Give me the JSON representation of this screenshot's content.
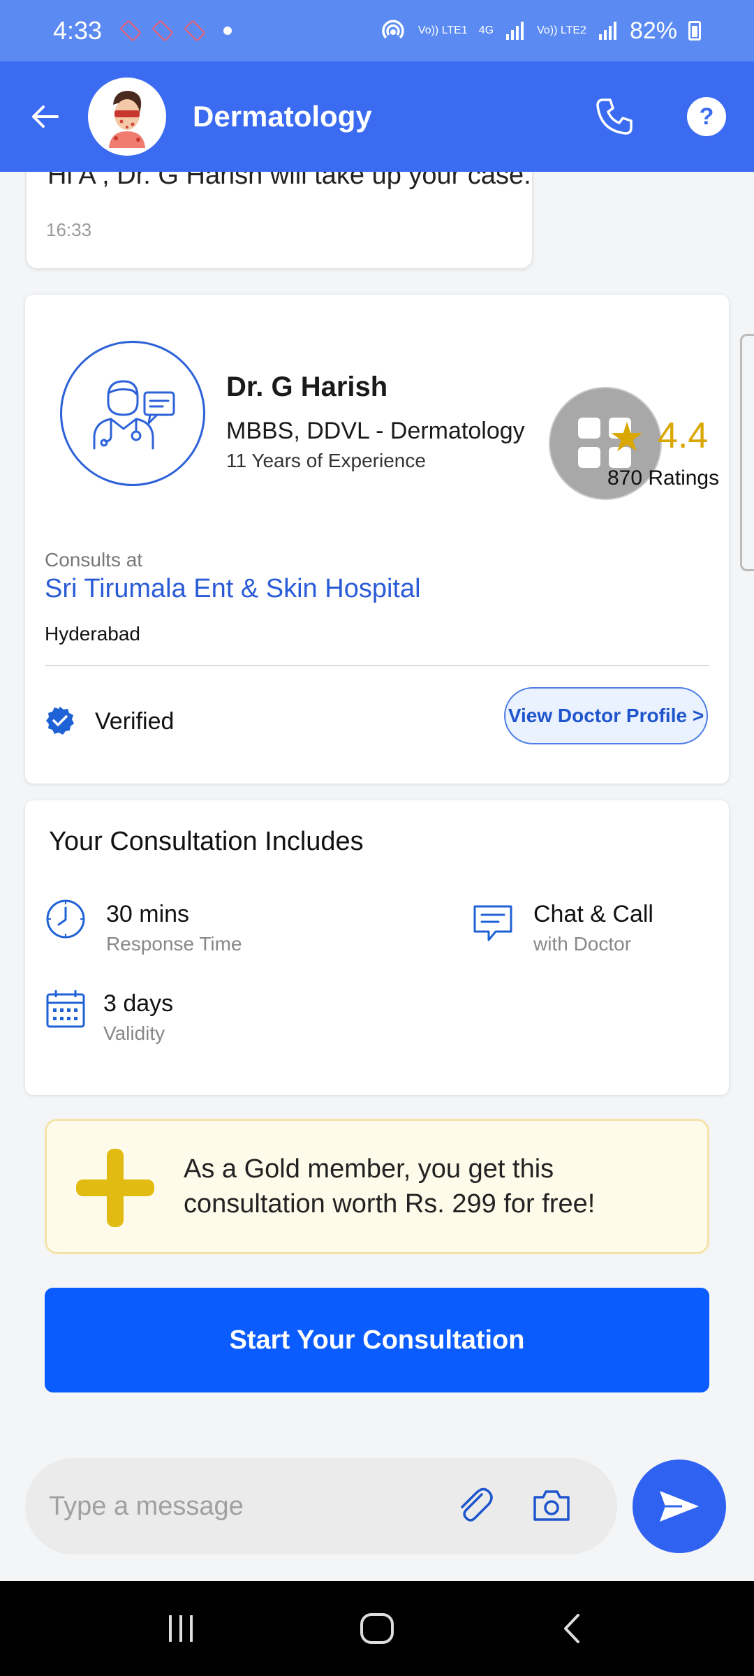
{
  "status_bar": {
    "time": "4:33",
    "sim1": "Vo)) LTE1",
    "net": "4G",
    "sim2": "Vo)) LTE2",
    "battery": "82%"
  },
  "header": {
    "title": "Dermatology"
  },
  "chat": {
    "message": "Hi A , Dr. G Harish will take up your case.",
    "time": "16:33"
  },
  "doctor": {
    "name": "Dr. G Harish",
    "qualification": "MBBS, DDVL - Dermatology",
    "experience": "11 Years of Experience",
    "rating": "4.4",
    "ratings_count": "870 Ratings",
    "consults_label": "Consults at",
    "hospital": "Sri Tirumala Ent & Skin Hospital",
    "city": "Hyderabad",
    "verified_label": "Verified",
    "profile_button": "View Doctor Profile >"
  },
  "includes": {
    "title": "Your Consultation Includes",
    "response_time_value": "30 mins",
    "response_time_label": "Response Time",
    "chat_call_value": "Chat & Call",
    "chat_call_label": "with Doctor",
    "validity_value": "3 days",
    "validity_label": "Validity"
  },
  "gold_banner": {
    "text": "As a Gold member, you get this consultation worth Rs. 299 for free!"
  },
  "cta": {
    "label": "Start Your Consultation"
  },
  "composer": {
    "placeholder": "Type a message",
    "value": ""
  },
  "colors": {
    "header_bg": "#3a6bf0",
    "status_bg": "#5a8af2",
    "cta_bg": "#0a5cff",
    "rating_gold": "#d9a700",
    "link_blue": "#2a5bd7"
  },
  "icons": [
    "back-arrow-icon",
    "phone-icon",
    "help-icon",
    "doctor-chat-icon",
    "grid-overlay-icon",
    "star-icon",
    "verified-badge-icon",
    "clock-icon",
    "chat-bubble-icon",
    "calendar-icon",
    "plus-icon",
    "paperclip-icon",
    "camera-icon",
    "send-icon",
    "recents-icon",
    "home-icon",
    "nav-back-icon"
  ]
}
